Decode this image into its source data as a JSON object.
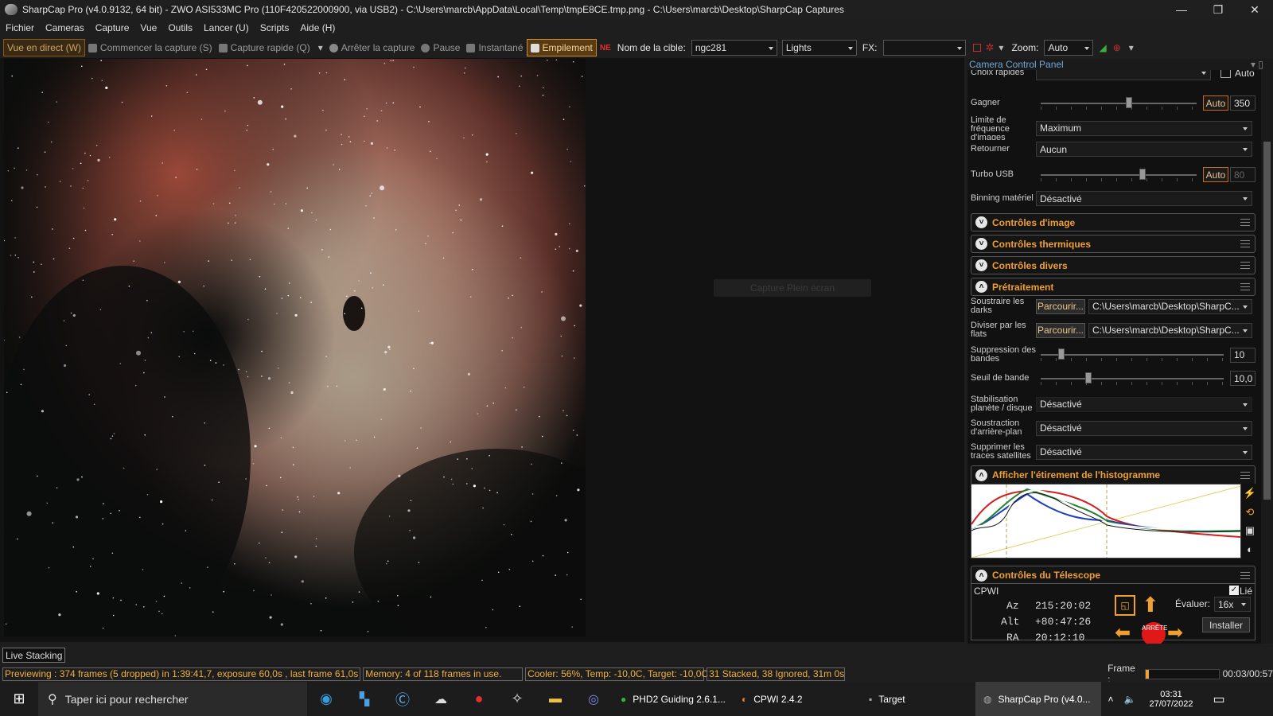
{
  "window": {
    "title": "SharpCap Pro (v4.0.9132, 64 bit) - ZWO ASI533MC Pro (110F420522000900, via USB2) - C:\\Users\\marcb\\AppData\\Local\\Temp\\tmpE8CE.tmp.png - C:\\Users\\marcb\\Desktop\\SharpCap Captures"
  },
  "menu": [
    "Fichier",
    "Cameras",
    "Capture",
    "Vue",
    "Outils",
    "Lancer (U)",
    "Scripts",
    "Aide (H)"
  ],
  "toolbar": {
    "live": "Vue en direct (W)",
    "start": "Commencer la capture (S)",
    "quick": "Capture rapide (Q)",
    "stop": "Arrêter la capture",
    "pause": "Pause",
    "snapshot": "Instantané",
    "stacking": "Empilement",
    "target_label": "Nom de la cible:",
    "target_value": "ngc281",
    "frame_type": "Lights",
    "fx_label": "FX:",
    "fx_value": "",
    "zoom_label": "Zoom:",
    "zoom_value": "Auto"
  },
  "viewer": {
    "fullscreen_button": "Capture Plein écran"
  },
  "panel": {
    "title": "Camera Control Panel",
    "quick_choice_label": "Choix rapides",
    "auto_label": "Auto",
    "gain_label": "Gagner",
    "gain_auto": "Auto",
    "gain_value": "350",
    "gain_level": 0.57,
    "fps_label": "Limite de fréquence d'images",
    "fps_value": "Maximum",
    "flip_label": "Retourner",
    "flip_value": "Aucun",
    "usb_label": "Turbo USB",
    "usb_auto": "Auto",
    "usb_value": "80",
    "usb_level": 0.66,
    "binning_label": "Binning matériel",
    "binning_value": "Désactivé",
    "sections": {
      "image": "Contrôles d'image",
      "thermal": "Contrôles thermiques",
      "misc": "Contrôles divers",
      "preprocess": "Prétraitement",
      "histogram": "Afficher l'étirement de l'histogramme",
      "telescope": "Contrôles du Télescope"
    },
    "darks_label": "Soustraire les darks",
    "darks_button": "Parcourir...",
    "darks_path": "C:\\Users\\marcb\\Desktop\\SharpC...",
    "flats_label": "Diviser par les flats",
    "flats_button": "Parcourir...",
    "flats_path": "C:\\Users\\marcb\\Desktop\\SharpC...",
    "banding_label": "Suppression des bandes",
    "banding_value": "10",
    "banding_level": 0.1,
    "threshold_label": "Seuil de bande",
    "threshold_value": "10,0",
    "threshold_level": 0.25,
    "stabilization_label": "Stabilisation planète / disque",
    "stabilization_value": "Désactivé",
    "background_label": "Soustraction d'arrière-plan",
    "background_value": "Désactivé",
    "satellite_label": "Supprimer les traces satellites",
    "satellite_value": "Désactivé",
    "telescope": {
      "name": "CPWI",
      "linked_label": "Lié",
      "az_label": "Az",
      "az_value": "215:20:02",
      "alt_label": "Alt",
      "alt_value": "+80:47:26",
      "ra_label": "RA",
      "ra_value": "20:12:10",
      "rate_label": "Évaluer:",
      "rate_value": "16x",
      "install_button": "Installer",
      "stop_label": "ARRÊTE"
    }
  },
  "live_stacking_tab": "Live Stacking",
  "status": {
    "preview": "Previewing : 374 frames (5 dropped) in 1:39:41,7, exposure 60,0s , last frame 61,0s",
    "memory": "Memory: 4 of 118 frames in use.",
    "cooler": "Cooler: 56%, Temp: -10,0C, Target: -10,0C",
    "stacked": "31 Stacked, 38 Ignored, 31m 0s",
    "frame_label": "Frame :",
    "frame_time": "00:03/00:57",
    "frame_progress": 0.05
  },
  "taskbar": {
    "search": "Taper ici pour rechercher",
    "apps": [
      "PHD2 Guiding 2.6.1...",
      "CPWI 2.4.2",
      "Target",
      "SharpCap Pro (v4.0..."
    ],
    "time": "03:31",
    "date": "27/07/2022"
  }
}
